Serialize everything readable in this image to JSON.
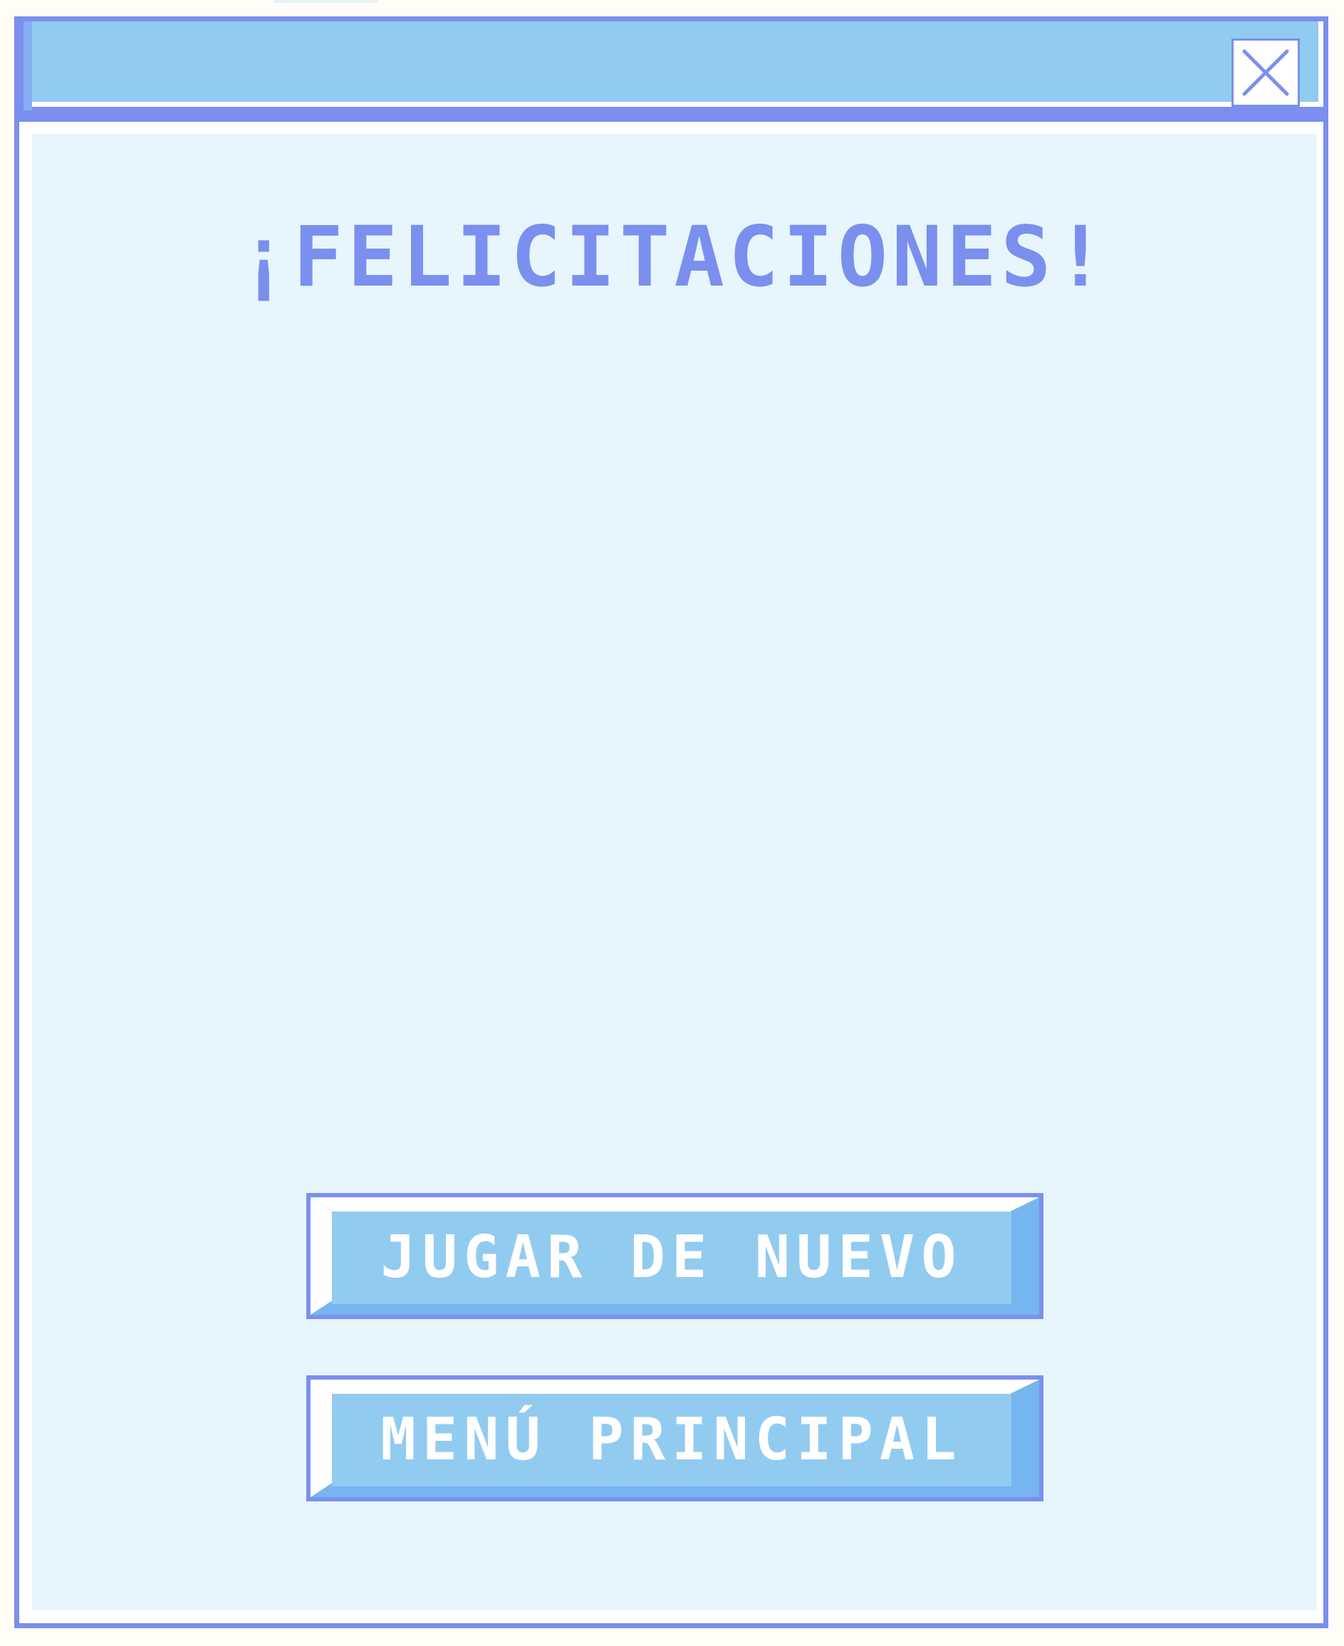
{
  "dialog": {
    "title": "¡FELICITACIONES!",
    "close_icon": "close-x-icon",
    "buttons": {
      "play_again": "JUGAR DE NUEVO",
      "main_menu": "MENÚ PRINCIPAL"
    }
  },
  "colors": {
    "accent": "#7b8fee",
    "titlebar": "#92cbf0",
    "content_bg": "#e7f5fd",
    "button_face": "#92cbf0",
    "button_shadow": "#76b5f0",
    "text_light": "#ffffff"
  }
}
